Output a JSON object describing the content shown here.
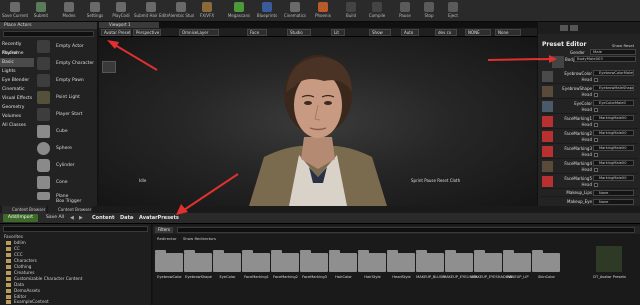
{
  "toolbar": {
    "buttons": [
      {
        "label": "Save Current",
        "icon": "save-icon"
      },
      {
        "label": "Submit",
        "icon": "source-control-icon"
      },
      {
        "label": "Modes",
        "icon": "modes-icon"
      },
      {
        "label": "Settings",
        "icon": "settings-icon"
      },
      {
        "label": "PlayCodi",
        "icon": "playcodi-icon"
      },
      {
        "label": "Submit Hair Edits",
        "icon": "hair-icon"
      },
      {
        "label": "Alembic Studio",
        "icon": "alembic-icon"
      },
      {
        "label": "FX/VFX",
        "icon": "fx-icon"
      },
      {
        "label": "Megascans",
        "icon": "megascans-icon"
      },
      {
        "label": "Blueprints",
        "icon": "blueprints-icon"
      },
      {
        "label": "Cinematics",
        "icon": "cinematics-icon"
      },
      {
        "label": "Phoenix",
        "icon": "phoenix-icon"
      },
      {
        "label": "Build",
        "icon": "build-icon"
      },
      {
        "label": "Compile",
        "icon": "compile-icon"
      },
      {
        "label": "Pause",
        "icon": "pause-icon"
      },
      {
        "label": "Stop",
        "icon": "stop-icon"
      },
      {
        "label": "Eject",
        "icon": "eject-icon"
      }
    ]
  },
  "place_actors": {
    "tab": "Place Actors",
    "categories": [
      "Recently Placed",
      "Keyframe",
      "Basic",
      "Lights",
      "Eye Blender",
      "Cinematic",
      "Visual Effects",
      "Geometry",
      "Volumes",
      "All Classes"
    ],
    "selected": "Basic",
    "actors": [
      "Empty Actor",
      "Empty Character",
      "Empty Pawn",
      "Point Light",
      "Player Start",
      "Cube",
      "Sphere",
      "Cylinder",
      "Cone",
      "Plane",
      "Box Trigger"
    ]
  },
  "viewport": {
    "tab": "Viewport 1",
    "bar": [
      "Avatar Presets",
      "Perspective",
      "OmniseLayer",
      "Face",
      "Studio",
      "Lit",
      "Show",
      "Auto",
      "dev cx",
      "NONE",
      "None"
    ],
    "status_left": "Idle",
    "status_right": "Sprint  Pause  Reset  Cloth"
  },
  "preset_editor": {
    "title": "Preset Editor",
    "show_reset": "Show Reset",
    "gender_label": "Gender",
    "gender_value": "Male",
    "body_label": "Body",
    "body_value": "BodyMale003",
    "rows": [
      {
        "label": "EyebrowColor",
        "value": "EyebrowColorMale0"
      },
      {
        "label": "EyebrowShape",
        "value": "EyebrowMaleShape"
      },
      {
        "label": "EyeColor",
        "value": "EyeColorMale0"
      },
      {
        "label": "FaceMarking1",
        "value": "MarkingMale00"
      },
      {
        "label": "FaceMarking2",
        "value": "MarkingMale00"
      },
      {
        "label": "FaceMarking3",
        "value": "MarkingMale00"
      },
      {
        "label": "FaceMarking4",
        "value": "MarkingMale00"
      },
      {
        "label": "FaceMarking5",
        "value": "MarkingMale00"
      },
      {
        "label": "Makeup_Lips",
        "value": "None"
      },
      {
        "label": "Makeup_Eye",
        "value": "None"
      }
    ],
    "head_label": "Head"
  },
  "content_browser": {
    "tabs": [
      "Content Browser 1",
      "Content Browser 2"
    ],
    "add_import": "Add/Import",
    "save_all": "Save All",
    "path": [
      "Content",
      "Data",
      "AvatarPresets"
    ],
    "filters_label": "Filters",
    "chips": [
      "Redirector",
      "Show Redirectors"
    ],
    "tree": [
      "Favorites",
      "bdlim",
      "CC",
      "CCC",
      "Characters",
      "Clothing",
      "Creatures",
      "Customizable Character Content",
      "Data",
      "DemoAssets",
      "Editor",
      "ExampleContent",
      "FinalAppearances"
    ],
    "assets": [
      "EyebrowColor",
      "EyebrowShape",
      "EyeColor",
      "FaceMarking1",
      "FaceMarking2",
      "FaceMarking3",
      "HairColor",
      "HairStyle",
      "HeadStyle",
      "MAKEUP_BLUSH",
      "MAKEUP_EYELINER",
      "MAKEUP_EYESHADOW",
      "MAKEUP_LIP",
      "SkinColor",
      "DT_Avatar Presets"
    ]
  }
}
